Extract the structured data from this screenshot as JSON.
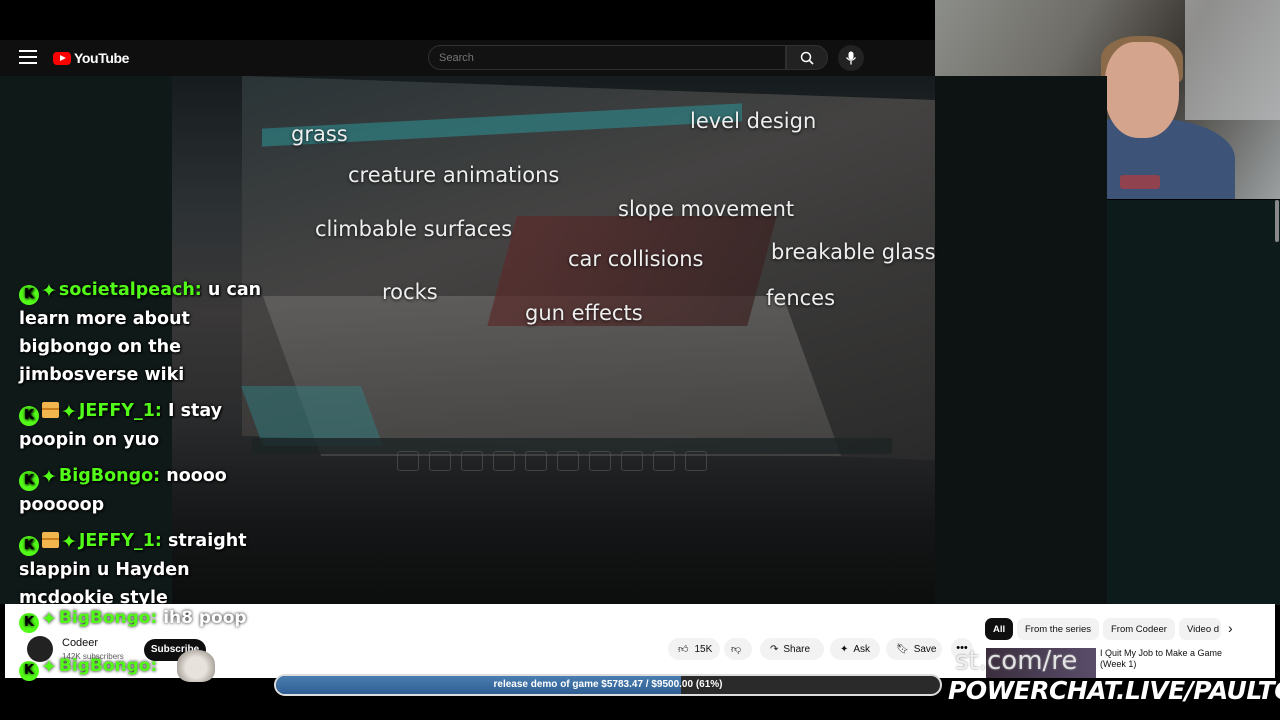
{
  "header": {
    "brand": "YouTube",
    "search_placeholder": "Search"
  },
  "overlay_words": {
    "grass": "grass",
    "level_design": "level design",
    "creature_animations": "creature animations",
    "slope_movement": "slope movement",
    "climbable_surfaces": "climbable surfaces",
    "car_collisions": "car collisions",
    "breakable_glass": "breakable glass",
    "rocks": "rocks",
    "fences": "fences",
    "gun_effects": "gun effects"
  },
  "chat": {
    "messages": [
      {
        "user": "societalpeach:",
        "text": "u can learn more about bigbongo on the jimbosverse wiki",
        "gift": false
      },
      {
        "user": "JEFFY_1:",
        "text": "I stay poopin on yuo",
        "gift": true
      },
      {
        "user": "BigBongo:",
        "text": "noooo pooooop",
        "gift": false
      },
      {
        "user": "JEFFY_1:",
        "text": "straight slappin u Hayden mcdookie style",
        "gift": true
      }
    ],
    "partial_1_user": "BigBongo:",
    "partial_1_text": "ih8 poop",
    "partial_2_user": "BigBongo:",
    "badge_letter": "K"
  },
  "channel": {
    "name": "Codeer",
    "subscribers": "142K subscribers",
    "subscribe_label": "Subscribe"
  },
  "actions": {
    "likes": "15K",
    "share": "Share",
    "ask": "Ask",
    "save": "Save",
    "more": "•••"
  },
  "chips": {
    "all": "All",
    "from_series": "From the series",
    "from_codeer": "From Codeer",
    "video": "Video d"
  },
  "recommendation": {
    "title": "I Quit My Job to Make a Game (Week 1)"
  },
  "watermark": "st.com/re",
  "goal": {
    "text": "release demo of game $5783.47 / $9500.00 (61%)",
    "progress": 0.61
  },
  "powerchat": "POWERCHAT.LIVE/PAULTOWN"
}
